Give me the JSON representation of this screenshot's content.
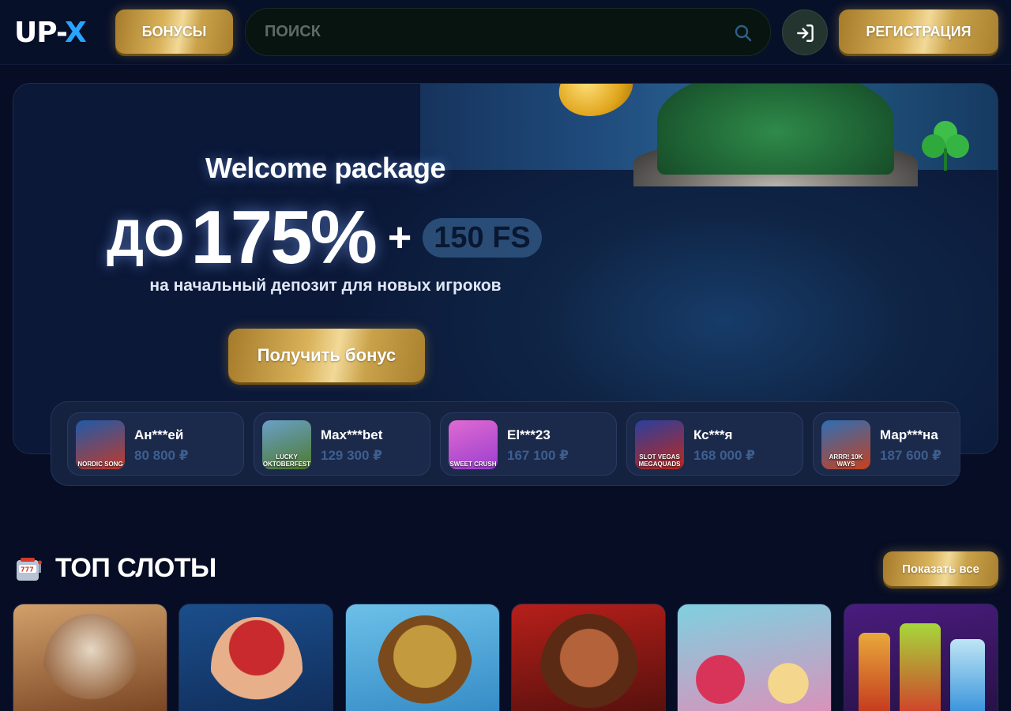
{
  "header": {
    "logo_up": "UP-",
    "logo_x": "X",
    "bonuses_label": "БОНУСЫ",
    "search_placeholder": "ПОИСК",
    "register_label": "РЕГИСТРАЦИЯ"
  },
  "hero": {
    "title": "Welcome package",
    "prefix": "ДО",
    "percent": "175%",
    "plus": "+",
    "fs": "150 FS",
    "subtitle": "на начальный депозит для новых игроков",
    "cta": "Получить бонус"
  },
  "winners": [
    {
      "name": "Ан***ей",
      "amount": "80 800 ₽",
      "game_label": "NORDIC SONG",
      "color_a": "#1f5aa8",
      "color_b": "#c23a2a"
    },
    {
      "name": "Max***bet",
      "amount": "129 300 ₽",
      "game_label": "LUCKY OKTOBERFEST",
      "color_a": "#6aa0c9",
      "color_b": "#4d7a2d"
    },
    {
      "name": "El***23",
      "amount": "167 100 ₽",
      "game_label": "SWEET CRUSH",
      "color_a": "#e06ad1",
      "color_b": "#9b3fd0"
    },
    {
      "name": "Кс***я",
      "amount": "168 000 ₽",
      "game_label": "SLOT VEGAS MEGAQUADS",
      "color_a": "#2a3f9e",
      "color_b": "#c0281c"
    },
    {
      "name": "Мар***на",
      "amount": "187 600 ₽",
      "game_label": "ARRR! 10K WAYS",
      "color_a": "#2d6fb5",
      "color_b": "#c7401e"
    }
  ],
  "top_slots": {
    "title": "ТОП СЛОТЫ",
    "show_all": "Показать все",
    "cards": [
      {
        "color_a": "#d2a06a",
        "color_b": "#6e3a1c"
      },
      {
        "color_a": "#1b4e8c",
        "color_b": "#b3252a"
      },
      {
        "color_a": "#6cc0e8",
        "color_b": "#c49a3e"
      },
      {
        "color_a": "#b71f1a",
        "color_b": "#4a0f0c"
      },
      {
        "color_a": "#7fd0e0",
        "color_b": "#d8345a"
      },
      {
        "color_a": "#4a1c7e",
        "color_b": "#8ec93b"
      }
    ]
  },
  "icons": {
    "search": "search-icon",
    "login": "login-icon",
    "slot_machine": "slot-machine-icon",
    "clover": "clover-icon"
  },
  "colors": {
    "background": "#060d24",
    "gold": "#d9b25a",
    "accent_blue": "#2aa3ff",
    "amount_blue": "#3c5f8f"
  }
}
